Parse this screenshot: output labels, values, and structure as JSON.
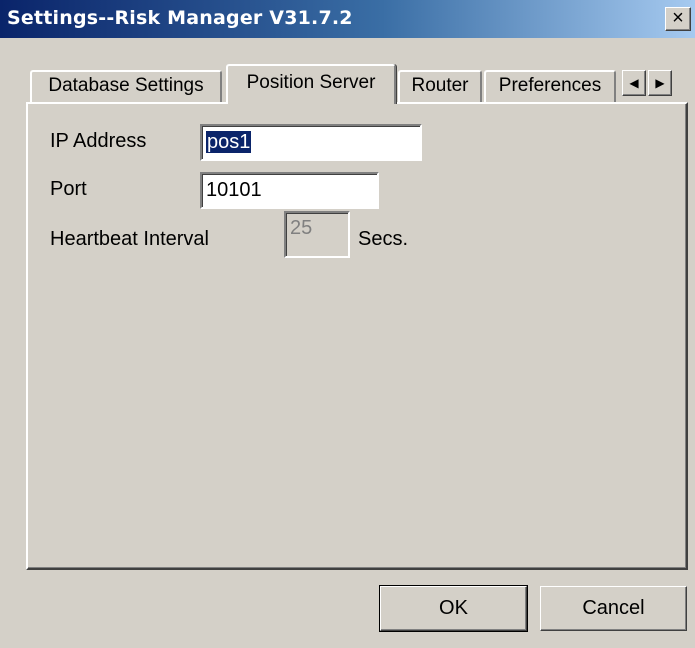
{
  "window": {
    "title": "Settings--Risk Manager V31.7.2",
    "close_label": "×"
  },
  "tabs": [
    {
      "label": "Database Settings",
      "active": false
    },
    {
      "label": "Position Server",
      "active": true
    },
    {
      "label": "Router",
      "active": false
    },
    {
      "label": "Preferences",
      "active": false
    }
  ],
  "tab_scroll": {
    "left": "◀",
    "right": "▶"
  },
  "form": {
    "ip_address_label": "IP Address",
    "ip_address_value": "pos1",
    "port_label": "Port",
    "port_value": "10101",
    "heartbeat_label": "Heartbeat Interval",
    "heartbeat_value": "25",
    "heartbeat_unit": "Secs."
  },
  "buttons": {
    "ok_label": "OK",
    "cancel_label": "Cancel"
  }
}
